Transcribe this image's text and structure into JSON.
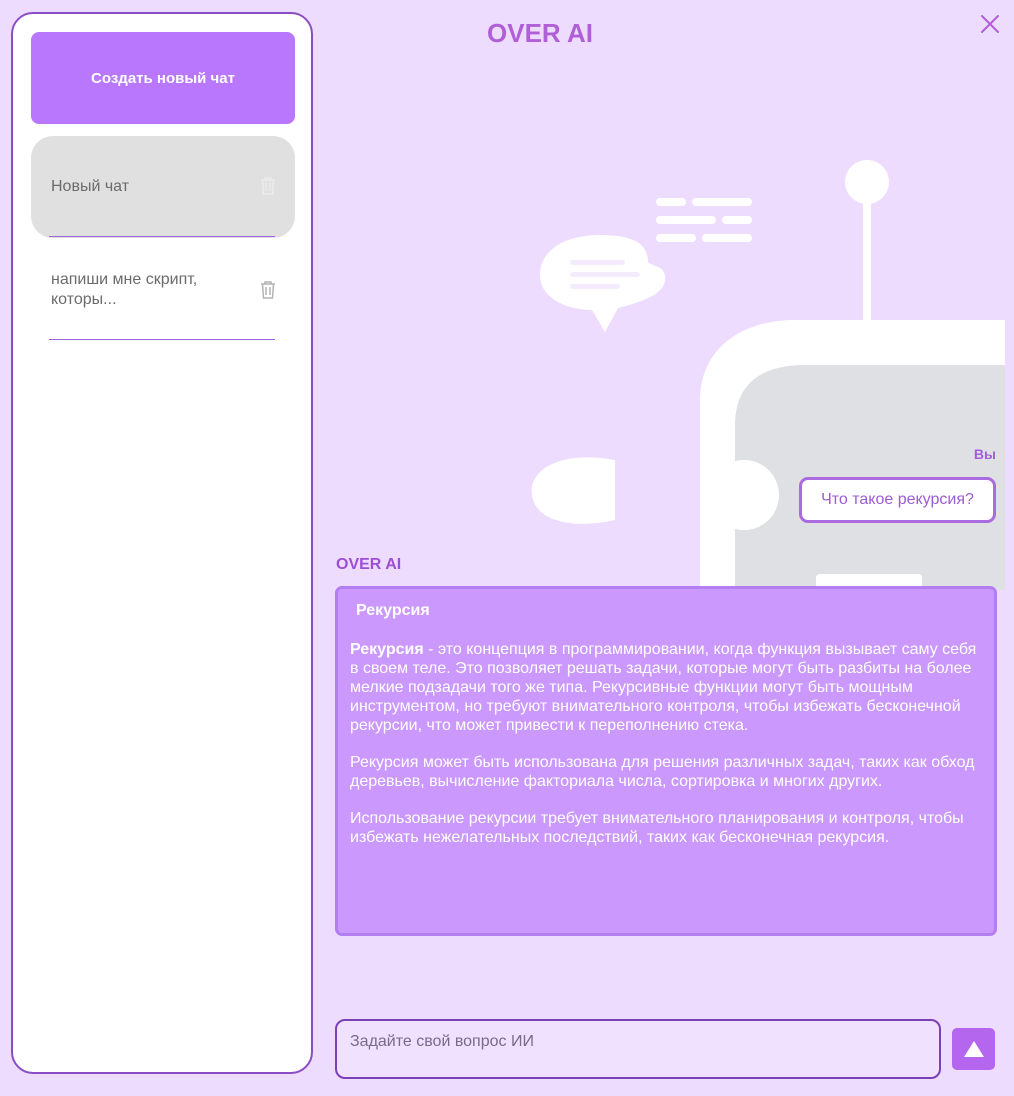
{
  "app_title": "OVER AI",
  "sidebar": {
    "new_chat_label": "Создать новый чат",
    "chats": [
      {
        "label": "Новый чат",
        "active": true
      },
      {
        "label": "напиши мне скрипт, которы...",
        "active": false
      }
    ]
  },
  "conversation": {
    "user_sender": "Вы",
    "user_message": "Что такое рекурсия?",
    "ai_sender": "OVER AI",
    "ai_heading": "Рекурсия",
    "ai_p1_bold": "Рекурсия",
    "ai_p1_rest": " - это концепция в программировании, когда функция вызывает саму себя в своем теле. Это позволяет решать задачи, которые могут быть разбиты на более мелкие подзадачи того же типа. Рекурсивные функции могут быть мощным инструментом, но требуют внимательного контроля, чтобы избежать бесконечной рекурсии, что может привести к переполнению стека.",
    "ai_p2": "Рекурсия может быть использована для решения различных задач, таких как обход деревьев, вычисление факториала числа, сортировка и многих других.",
    "ai_p3": "Использование рекурсии требует внимательного планирования и контроля, чтобы избежать нежелательных последствий, таких как бесконечная рекурсия."
  },
  "input": {
    "placeholder": "Задайте свой вопрос ИИ"
  },
  "icons": {
    "close": "close-icon",
    "trash": "trash-icon",
    "send": "arrow-up-icon",
    "robot": "robot-illustration"
  },
  "colors": {
    "background": "#eddcfe",
    "accent": "#b977fe",
    "ai_bubble": "#cb98fd",
    "title": "#b15fd9"
  }
}
